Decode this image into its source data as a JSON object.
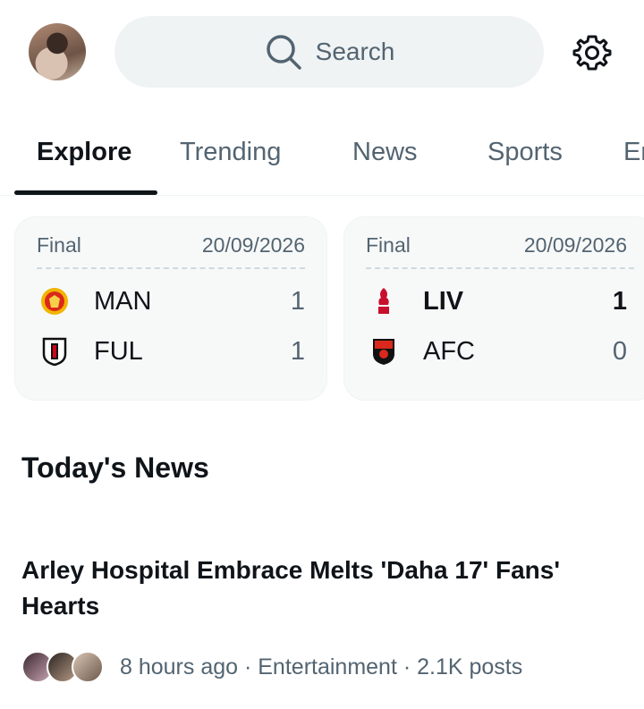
{
  "search": {
    "placeholder": "Search"
  },
  "tabs": [
    {
      "label": "Explore"
    },
    {
      "label": "Trending"
    },
    {
      "label": "News"
    },
    {
      "label": "Sports"
    },
    {
      "label": "Er"
    }
  ],
  "scores": [
    {
      "status": "Final",
      "date": "20/09/2026",
      "home": {
        "name": "MAN",
        "score": "1",
        "logo": "manchester-united-crest"
      },
      "away": {
        "name": "FUL",
        "score": "1",
        "logo": "fulham-crest"
      }
    },
    {
      "status": "Final",
      "date": "20/09/2026",
      "home": {
        "name": "LIV",
        "score": "1",
        "logo": "liverpool-crest"
      },
      "away": {
        "name": "AFC",
        "score": "0",
        "logo": "bournemouth-crest"
      }
    }
  ],
  "news": {
    "section_title": "Today's News",
    "headline": "Arley Hospital Embrace Melts 'Daha 17' Fans' Hearts",
    "meta": "8 hours ago · Entertainment · 2.1K posts"
  },
  "colors": {
    "text": "#0f1419",
    "muted": "#536471",
    "search_bg": "#eff3f4",
    "card_bg": "#f7f9f9"
  }
}
